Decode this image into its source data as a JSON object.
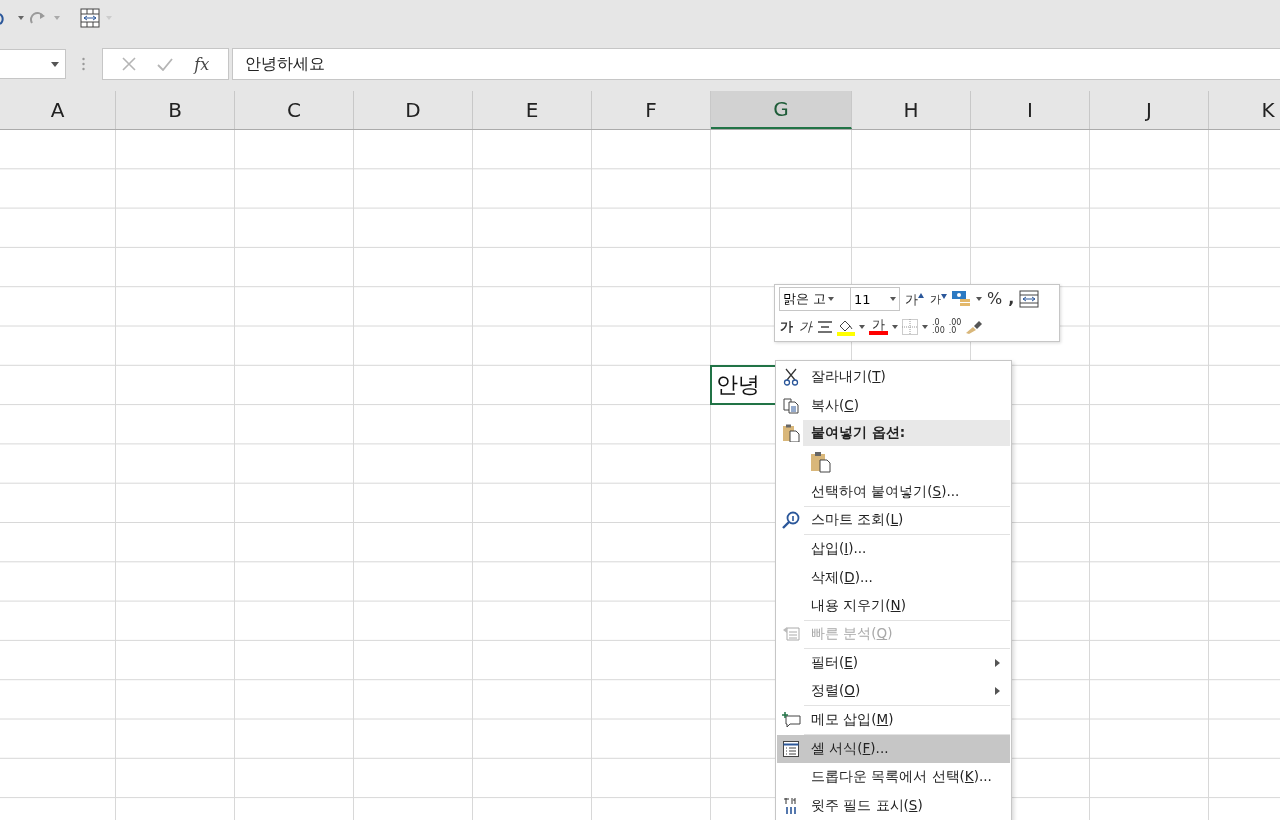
{
  "quick_access": {
    "undo_enabled": true,
    "redo_enabled": false
  },
  "formula_bar": {
    "fx": "fx",
    "value": "안녕하세요"
  },
  "columns": [
    {
      "label": "A",
      "selected": false
    },
    {
      "label": "B",
      "selected": false
    },
    {
      "label": "C",
      "selected": false
    },
    {
      "label": "D",
      "selected": false
    },
    {
      "label": "E",
      "selected": false
    },
    {
      "label": "F",
      "selected": false
    },
    {
      "label": "G",
      "selected": true
    },
    {
      "label": "H",
      "selected": false
    },
    {
      "label": "I",
      "selected": false
    },
    {
      "label": "J",
      "selected": false
    },
    {
      "label": "K",
      "selected": false
    }
  ],
  "active_cell_text": "안녕",
  "mini_toolbar": {
    "font": "맑은 고",
    "size": "11",
    "grow": "가",
    "shrink": "가",
    "percent": "%",
    "comma": ",",
    "bold": "가",
    "italic": "가",
    "font_color_glyph": "가",
    "increase_decimal": [
      ".0",
      ".00"
    ],
    "decrease_decimal": [
      ".00",
      ".0"
    ]
  },
  "context_menu": [
    {
      "kind": "item",
      "before": "잘라내기(",
      "key": "T",
      "after": ")",
      "disabled": false,
      "selected": false,
      "submenu": false,
      "separator_after": false
    },
    {
      "kind": "item",
      "before": "복사(",
      "key": "C",
      "after": ")",
      "disabled": false,
      "selected": false,
      "submenu": false,
      "separator_after": false
    },
    {
      "kind": "header",
      "before": "붙여넣기 옵션:",
      "disabled": false,
      "selected": false,
      "submenu": false,
      "separator_after": false
    },
    {
      "kind": "paste-options"
    },
    {
      "kind": "item",
      "before": "선택하여 붙여넣기(",
      "key": "S",
      "after": ")...",
      "disabled": false,
      "selected": false,
      "submenu": false,
      "separator_after": true
    },
    {
      "kind": "item",
      "before": "스마트 조회(",
      "key": "L",
      "after": ")",
      "disabled": false,
      "selected": false,
      "submenu": false,
      "separator_after": true
    },
    {
      "kind": "item",
      "before": "삽입(",
      "key": "I",
      "after": ")...",
      "disabled": false,
      "selected": false,
      "submenu": false,
      "separator_after": false
    },
    {
      "kind": "item",
      "before": "삭제(",
      "key": "D",
      "after": ")...",
      "disabled": false,
      "selected": false,
      "submenu": false,
      "separator_after": false
    },
    {
      "kind": "item",
      "before": "내용 지우기(",
      "key": "N",
      "after": ")",
      "disabled": false,
      "selected": false,
      "submenu": false,
      "separator_after": true
    },
    {
      "kind": "item",
      "before": "빠른 분석(",
      "key": "Q",
      "after": ")",
      "disabled": true,
      "selected": false,
      "submenu": false,
      "separator_after": true
    },
    {
      "kind": "item",
      "before": "필터(",
      "key": "E",
      "after": ")",
      "disabled": false,
      "selected": false,
      "submenu": true,
      "separator_after": false
    },
    {
      "kind": "item",
      "before": "정렬(",
      "key": "O",
      "after": ")",
      "disabled": false,
      "selected": false,
      "submenu": true,
      "separator_after": true
    },
    {
      "kind": "item",
      "before": "메모 삽입(",
      "key": "M",
      "after": ")",
      "disabled": false,
      "selected": false,
      "submenu": false,
      "separator_after": true
    },
    {
      "kind": "item",
      "before": "셀 서식(",
      "key": "F",
      "after": ")...",
      "disabled": false,
      "selected": true,
      "submenu": false,
      "separator_after": false
    },
    {
      "kind": "item",
      "before": "드롭다운 목록에서 선택(",
      "key": "K",
      "after": ")...",
      "disabled": false,
      "selected": false,
      "submenu": false,
      "separator_after": false
    },
    {
      "kind": "item",
      "before": "윗주 필드 표시(",
      "key": "S",
      "after": ")",
      "disabled": false,
      "selected": false,
      "submenu": false,
      "separator_after": false
    }
  ]
}
